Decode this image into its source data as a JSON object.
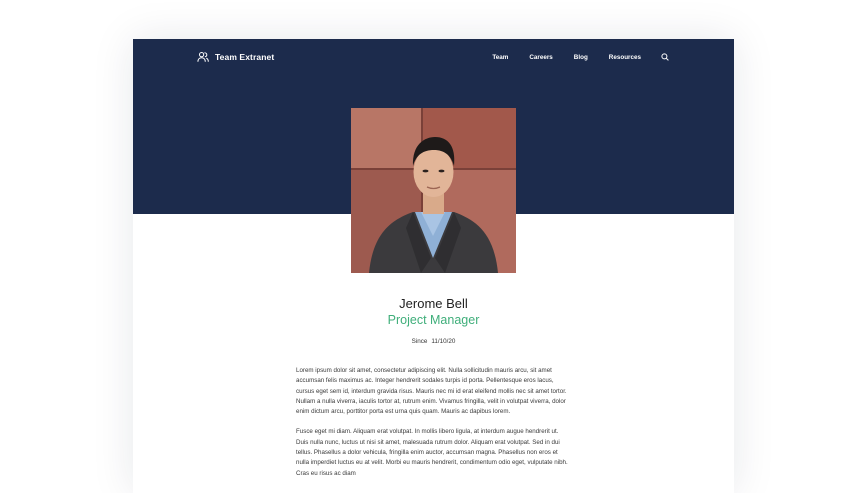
{
  "brand": {
    "name": "Team Extranet",
    "icon": "users-icon"
  },
  "nav": {
    "items": [
      {
        "label": "Team"
      },
      {
        "label": "Careers"
      },
      {
        "label": "Blog"
      },
      {
        "label": "Resources"
      }
    ],
    "search_icon": "search-icon"
  },
  "colors": {
    "hero_background": "#1c2b4c",
    "accent": "#3fae7a",
    "text": "#222222"
  },
  "profile": {
    "name": "Jerome Bell",
    "role": "Project Manager",
    "since_label": "Since",
    "since_date": "11/10/20",
    "bio": [
      "Lorem ipsum dolor sit amet, consectetur adipiscing elit. Nulla sollicitudin mauris arcu, sit amet accumsan felis maximus ac. Integer hendrerit sodales turpis id porta. Pellentesque eros lacus, cursus eget sem id, interdum gravida risus. Mauris nec mi id erat eleifend mollis nec sit amet tortor. Nullam a nulla viverra, iaculis tortor at, rutrum enim. Vivamus fringilla, velit in volutpat viverra, dolor enim dictum arcu, porttitor porta est urna quis quam. Mauris ac dapibus lorem.",
      "Fusce eget mi diam. Aliquam erat volutpat. In mollis libero ligula, at interdum augue hendrerit ut. Duis nulla nunc, luctus ut nisi sit amet, malesuada rutrum dolor. Aliquam erat volutpat. Sed in dui tellus. Phasellus a dolor vehicula, fringilla enim auctor, accumsan magna. Phasellus non eros et nulla imperdiet luctus eu at velit. Morbi eu mauris hendrerit, condimentum odio eget, vulputate nibh. Cras eu risus ac diam"
    ]
  }
}
